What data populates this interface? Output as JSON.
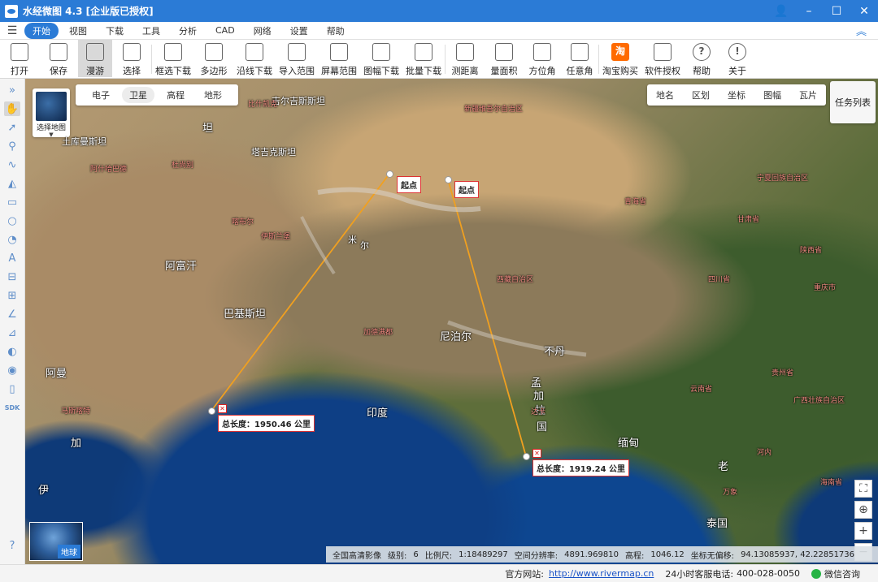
{
  "window": {
    "title": "水经微图 4.3 [企业版已授权]"
  },
  "menu": {
    "items": [
      "开始",
      "视图",
      "下载",
      "工具",
      "分析",
      "CAD",
      "网络",
      "设置",
      "帮助"
    ],
    "active": "开始"
  },
  "toolbar": {
    "open": "打开",
    "save": "保存",
    "pan": "漫游",
    "select": "选择",
    "box_download": "框选下载",
    "polygon": "多边形",
    "line_download": "沿线下载",
    "import_range": "导入范围",
    "screen_range": "屏幕范围",
    "sheet_download": "图幅下载",
    "batch_download": "批量下载",
    "measure_distance": "测距离",
    "measure_area": "量面积",
    "azimuth": "方位角",
    "any_angle": "任意角",
    "taobao_buy": "淘宝购买",
    "software_license": "软件授权",
    "help": "帮助",
    "about": "关于",
    "taobao_glyph": "淘",
    "help_glyph": "?",
    "about_glyph": "!"
  },
  "left_tools": {
    "sdk": "SDK"
  },
  "map": {
    "layer_tabs": [
      "电子",
      "卫星",
      "高程",
      "地形"
    ],
    "active_layer": "卫星",
    "map_select": "选择地图",
    "right_tabs": [
      "地名",
      "区划",
      "坐标",
      "图幅",
      "瓦片"
    ],
    "task_list": "任务列表",
    "globe_label": "地球",
    "labels": {
      "kyrgyzstan": "吉尔吉斯斯坦",
      "tajikistan": "塔吉克斯坦",
      "turkmenistan": "土库曼斯坦",
      "afghanistan": "阿富汗",
      "pakistan": "巴基斯坦",
      "nepal": "尼泊尔",
      "bhutan": "不丹",
      "india": "印度",
      "oman": "阿曼",
      "bangladesh_1": "孟",
      "bangladesh_2": "加",
      "bangladesh_3": "拉",
      "bangladesh_4": "国",
      "myanmar": "缅甸",
      "laos": "老",
      "thailand": "泰国",
      "tan": "坦",
      "jia": "加",
      "mi": "米",
      "er": "尔",
      "tiao": "挑",
      "yi": "伊",
      "tan2": "坦",
      "xinjiang": "新疆维吾尔自治区",
      "tibet": "西藏自治区",
      "qinghai": "青海省",
      "gansu": "甘肃省",
      "ningxia": "宁夏回族自治区",
      "shaanxi": "陕西省",
      "sichuan": "四川省",
      "chongqing": "重庆市",
      "guizhou": "贵州省",
      "yunnan": "云南省",
      "guangxi": "广西壮族自治区",
      "hainan": "海南省",
      "hanoi": "河内",
      "wanxiang": "万象",
      "nepal_ka": "加德满都",
      "islamabad": "伊斯兰堡",
      "kabul": "喀布尔",
      "delhi": "新德里",
      "dhaka": "达卡",
      "muscat": "马斯喀特",
      "tashkent": "塔什干",
      "ashgabat": "阿什哈巴德",
      "bishkek": "比什凯克",
      "dushanbe": "杜尚别"
    },
    "start_label": "起点",
    "line1_total": "总长度：1950.46 公里",
    "line2_total": "总长度：1919.24 公里",
    "zoom_in": "+",
    "zoom_out": "−"
  },
  "info": {
    "source": "全国高清影像",
    "level_label": "级别:",
    "level": "6",
    "scale_label": "比例尺:",
    "scale": "1:18489297",
    "resolution_label": "空间分辨率:",
    "resolution": "4891.969810",
    "elevation_label": "高程:",
    "elevation": "1046.12",
    "offset_label": "坐标无偏移:",
    "coords": "94.13085937, 42.22851736"
  },
  "footer": {
    "site_label": "官方网站:",
    "site": "http://www.rivermap.cn",
    "hotline_label": "24小时客服电话:",
    "hotline": "400-028-0050",
    "wechat": "微信咨询"
  },
  "colors": {
    "accent": "#2b7bd6",
    "route_line": "#f0a020",
    "tag_border": "#dd3333"
  }
}
